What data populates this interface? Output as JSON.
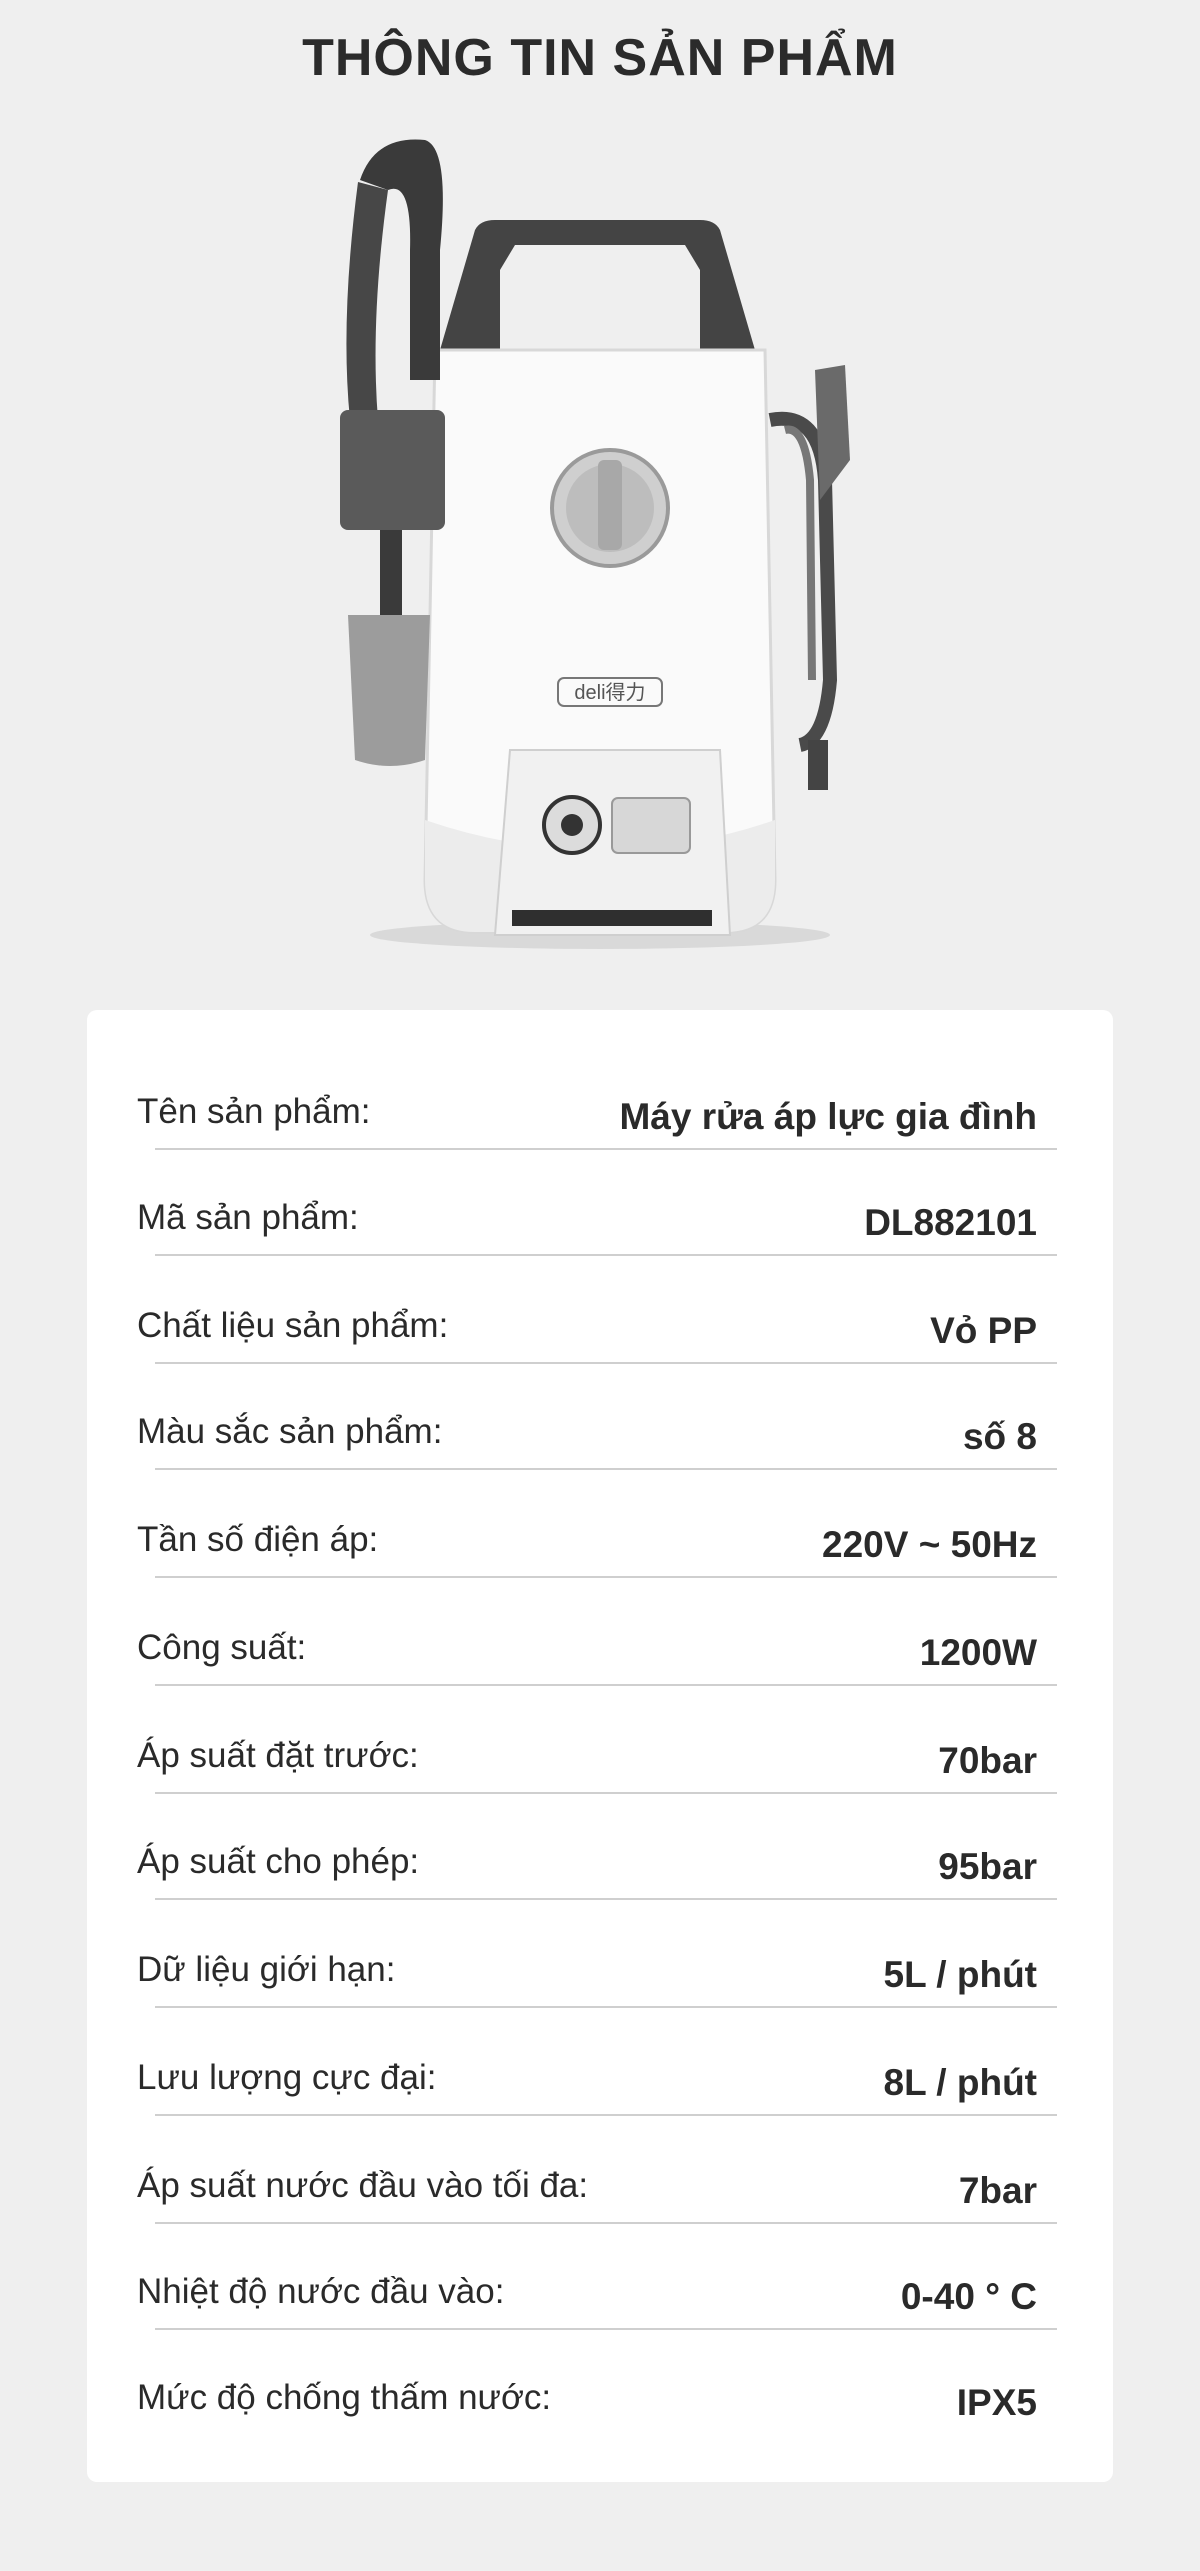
{
  "page": {
    "title": "THÔNG TIN SẢN PHẨM"
  },
  "product": {
    "brand": "deli得力"
  },
  "specs": [
    {
      "label": "Tên sản phẩm:",
      "value": "Máy rửa áp lực gia đình"
    },
    {
      "label": "Mã sản phẩm:",
      "value": "DL882101"
    },
    {
      "label": "Chất liệu sản phẩm:",
      "value": "Vỏ PP"
    },
    {
      "label": "Màu sắc sản phẩm:",
      "value": "số 8"
    },
    {
      "label": "Tần số điện áp:",
      "value": "220V ~ 50Hz"
    },
    {
      "label": "Công suất:",
      "value": "1200W"
    },
    {
      "label": "Áp suất đặt trước:",
      "value": "70bar"
    },
    {
      "label": "Áp suất cho phép:",
      "value": "95bar"
    },
    {
      "label": "Dữ liệu giới hạn:",
      "value": "5L / phút"
    },
    {
      "label": "Lưu lượng cực đại:",
      "value": "8L / phút"
    },
    {
      "label": "Áp suất nước đầu vào tối đa:",
      "value": "7bar"
    },
    {
      "label": "Nhiệt độ nước đầu vào:",
      "value": "0-40 ° C"
    },
    {
      "label": "Mức độ chống thấm nước:",
      "value": "IPX5"
    }
  ]
}
